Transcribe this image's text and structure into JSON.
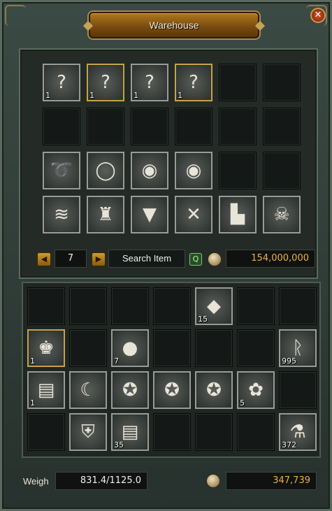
{
  "window": {
    "title": "Warehouse",
    "close_symbol": "✕"
  },
  "storage": {
    "slots": [
      {
        "icon": "mystery-scroll-icon",
        "glyph": "?",
        "qty": "1",
        "frame": "silver"
      },
      {
        "icon": "mystery-scroll-icon",
        "glyph": "?",
        "qty": "1",
        "frame": "gold"
      },
      {
        "icon": "mystery-scroll-icon",
        "glyph": "?",
        "qty": "1",
        "frame": "silver"
      },
      {
        "icon": "mystery-scroll-icon",
        "glyph": "?",
        "qty": "1",
        "frame": "gold"
      },
      null,
      null,
      null,
      null,
      null,
      null,
      null,
      null,
      {
        "icon": "necklace-icon",
        "glyph": "➰",
        "qty": "",
        "frame": "silver"
      },
      {
        "icon": "ring-icon",
        "glyph": "◯",
        "qty": "",
        "frame": "silver"
      },
      {
        "icon": "earring-icon",
        "glyph": "◉",
        "qty": "",
        "frame": "silver"
      },
      {
        "icon": "earring-icon",
        "glyph": "◉",
        "qty": "",
        "frame": "silver"
      },
      null,
      null,
      {
        "icon": "bracelet-icon",
        "glyph": "≋",
        "qty": "",
        "frame": "silver"
      },
      {
        "icon": "armor-icon",
        "glyph": "♜",
        "qty": "",
        "frame": "silver"
      },
      {
        "icon": "pants-icon",
        "glyph": "▼",
        "qty": "",
        "frame": "silver"
      },
      {
        "icon": "gloves-icon",
        "glyph": "✕",
        "qty": "",
        "frame": "silver"
      },
      {
        "icon": "boots-icon",
        "glyph": "▙",
        "qty": "",
        "frame": "silver"
      },
      {
        "icon": "helmet-icon",
        "glyph": "☠",
        "qty": "",
        "frame": "silver"
      }
    ]
  },
  "controls": {
    "prev_symbol": "◀",
    "next_symbol": "▶",
    "page": "7",
    "search_label": "Search Item",
    "search_icon_symbol": "Q",
    "warehouse_gold": "154,000,000"
  },
  "inventory": {
    "slots": [
      null,
      null,
      null,
      null,
      {
        "icon": "blue-crystal-icon",
        "glyph": "◆",
        "qty": "15",
        "frame": "silver"
      },
      null,
      null,
      {
        "icon": "jade-statue-icon",
        "glyph": "♚",
        "qty": "1",
        "frame": "gold"
      },
      null,
      {
        "icon": "pearls-icon",
        "glyph": "●",
        "qty": "7",
        "frame": "silver"
      },
      null,
      null,
      null,
      {
        "icon": "blue-rune-icon",
        "glyph": "ᚱ",
        "qty": "995",
        "frame": "silver"
      },
      {
        "icon": "blue-scroll-icon",
        "glyph": "▤",
        "qty": "1",
        "frame": "silver"
      },
      {
        "icon": "parchment-icon",
        "glyph": "☾",
        "qty": "",
        "frame": "silver"
      },
      {
        "icon": "sheriff-badge-icon",
        "glyph": "✪",
        "qty": "",
        "frame": "silver"
      },
      {
        "icon": "sheriff-badge-icon",
        "glyph": "✪",
        "qty": "",
        "frame": "silver"
      },
      {
        "icon": "sheriff-badge-icon",
        "glyph": "✪",
        "qty": "",
        "frame": "silver"
      },
      {
        "icon": "purple-flower-icon",
        "glyph": "✿",
        "qty": "5",
        "frame": "silver"
      },
      null,
      null,
      {
        "icon": "silver-armor-icon",
        "glyph": "⛨",
        "qty": "",
        "frame": "silver"
      },
      {
        "icon": "blue-scroll-icon",
        "glyph": "▤",
        "qty": "35",
        "frame": "silver"
      },
      null,
      null,
      null,
      {
        "icon": "blue-potion-icon",
        "glyph": "⚗",
        "qty": "372",
        "frame": "silver"
      }
    ]
  },
  "footer": {
    "weigh_label": "Weigh",
    "weight": "831.4/1125.0",
    "inventory_gold": "347,739"
  },
  "colors": {
    "gold_text": "#f0b040",
    "title_plate": "#b0781e"
  }
}
